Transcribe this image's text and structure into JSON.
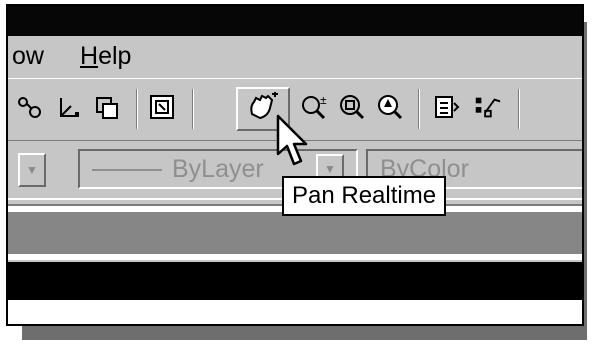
{
  "menu": {
    "partial_label": "ow",
    "help_accel": "H",
    "help_rest": "elp"
  },
  "toolbar": {
    "icons": [
      "osnap-icon",
      "ucs-icon",
      "view-icon",
      "named-views-icon",
      "pan-realtime-icon",
      "zoom-realtime-icon",
      "zoom-window-icon",
      "zoom-previous-icon",
      "properties-icon",
      "match-properties-icon"
    ]
  },
  "properties_bar": {
    "linetype_value": "ByLayer",
    "color_value": "ByColor"
  },
  "tooltip": {
    "text": "Pan Realtime"
  }
}
